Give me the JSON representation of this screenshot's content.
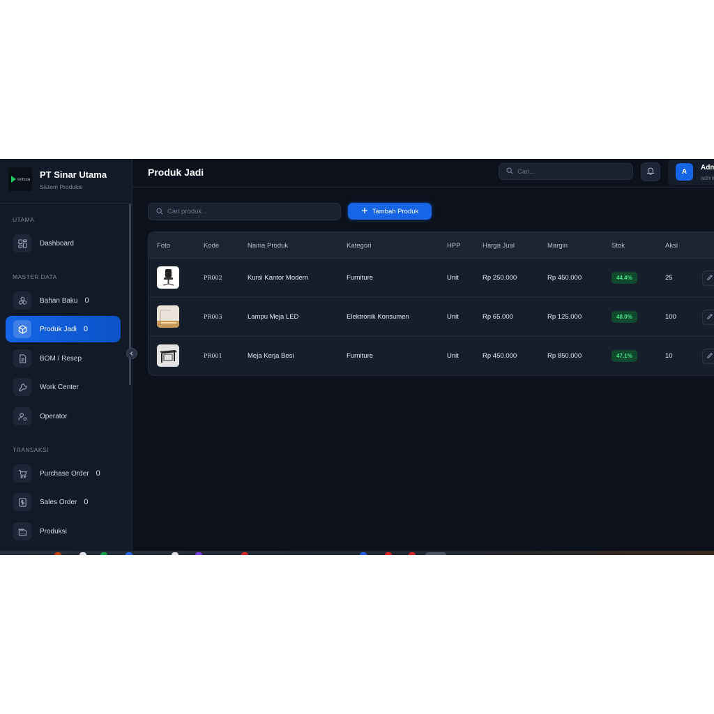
{
  "sidebar": {
    "logo_text": "SY-TECH",
    "company": "PT Sinar Utama",
    "subtitle": "Sistem Produksi",
    "sections": {
      "utama": "UTAMA",
      "master": "MASTER DATA",
      "transaksi": "TRANSAKSI"
    },
    "items": [
      {
        "label": "Dashboard",
        "icon": "layout-grid-icon"
      },
      {
        "label": "Bahan Baku",
        "count": "0",
        "icon": "boxes-icon"
      },
      {
        "label": "Produk Jadi",
        "count": "0",
        "icon": "package-icon",
        "active": true
      },
      {
        "label": "BOM / Resep",
        "icon": "file-text-icon"
      },
      {
        "label": "Work Center",
        "icon": "wrench-icon"
      },
      {
        "label": "Operator",
        "icon": "user-cog-icon"
      },
      {
        "label": "Purchase Order",
        "count": "0",
        "icon": "shopping-cart-icon"
      },
      {
        "label": "Sales Order",
        "count": "0",
        "icon": "dollar-receipt-icon"
      },
      {
        "label": "Produksi",
        "icon": "factory-icon"
      }
    ]
  },
  "header": {
    "title": "Produk Jadi",
    "search_placeholder": "Cari...",
    "user_initial": "A",
    "user_name": "Admin",
    "user_role": "admin"
  },
  "toolbar": {
    "search_placeholder": "Cari produk...",
    "add_label": "Tambah Produk"
  },
  "table": {
    "columns": [
      "Foto",
      "Kode",
      "Nama Produk",
      "Kategori",
      "HPP",
      "Harga Jual",
      "Margin",
      "Stok",
      "Aksi"
    ],
    "rows": [
      {
        "kode": "PR002",
        "nama": "Kursi Kantor Modern",
        "kategori": "Furniture",
        "satuan": "Unit",
        "hpp": "Rp 250.000",
        "harga_jual": "Rp 450.000",
        "margin": "44.4%",
        "stok": "25",
        "photo": "office-chair"
      },
      {
        "kode": "PR003",
        "nama": "Lampu Meja LED",
        "kategori": "Elektronik Konsumen",
        "satuan": "Unit",
        "hpp": "Rp 65.000",
        "harga_jual": "Rp 125.000",
        "margin": "48.0%",
        "stok": "100",
        "photo": "desk-lamp"
      },
      {
        "kode": "PR001",
        "nama": "Meja Kerja Besi",
        "kategori": "Furniture",
        "satuan": "Unit",
        "hpp": "Rp 450.000",
        "harga_jual": "Rp 850.000",
        "margin": "47.1%",
        "stok": "10",
        "photo": "metal-desk"
      }
    ]
  },
  "colors": {
    "accent": "#1565e6",
    "background": "#0c111b",
    "sidebar": "#121a27",
    "badge_text": "#4ade80",
    "badge_bg": "#0f4a2e"
  }
}
